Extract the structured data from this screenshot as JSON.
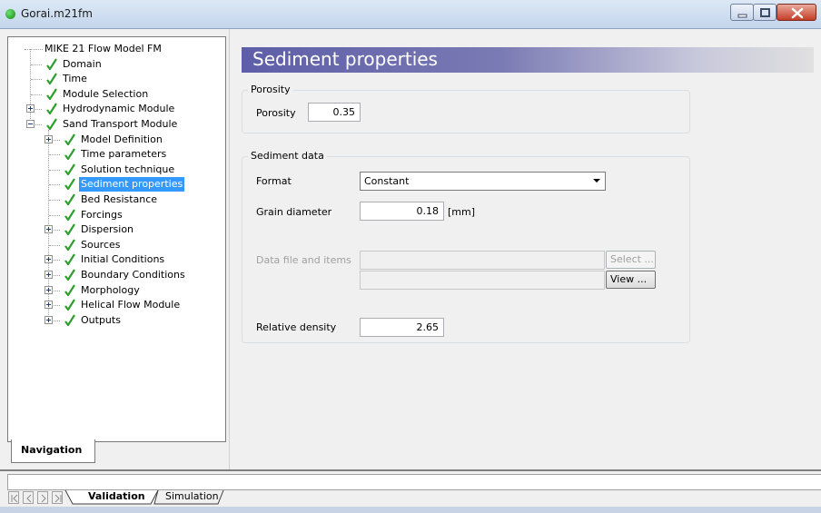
{
  "window": {
    "title": "Gorai.m21fm"
  },
  "navigation": {
    "tab_label": "Navigation",
    "tree": [
      {
        "label": "MIKE 21 Flow Model FM",
        "level": 0,
        "expander": null,
        "check": false
      },
      {
        "label": "Domain",
        "level": 1,
        "expander": null,
        "check": true
      },
      {
        "label": "Time",
        "level": 1,
        "expander": null,
        "check": true
      },
      {
        "label": "Module Selection",
        "level": 1,
        "expander": null,
        "check": true
      },
      {
        "label": "Hydrodynamic Module",
        "level": 1,
        "expander": "plus",
        "check": true
      },
      {
        "label": "Sand Transport Module",
        "level": 1,
        "expander": "minus",
        "check": true
      },
      {
        "label": "Model Definition",
        "level": 2,
        "expander": "plus",
        "check": true
      },
      {
        "label": "Time parameters",
        "level": 2,
        "expander": null,
        "check": true
      },
      {
        "label": "Solution technique",
        "level": 2,
        "expander": null,
        "check": true
      },
      {
        "label": "Sediment properties",
        "level": 2,
        "expander": null,
        "check": true,
        "selected": true
      },
      {
        "label": "Bed Resistance",
        "level": 2,
        "expander": null,
        "check": true
      },
      {
        "label": "Forcings",
        "level": 2,
        "expander": null,
        "check": true
      },
      {
        "label": "Dispersion",
        "level": 2,
        "expander": "plus",
        "check": true
      },
      {
        "label": "Sources",
        "level": 2,
        "expander": null,
        "check": true
      },
      {
        "label": "Initial Conditions",
        "level": 2,
        "expander": "plus",
        "check": true
      },
      {
        "label": "Boundary Conditions",
        "level": 2,
        "expander": "plus",
        "check": true
      },
      {
        "label": "Morphology",
        "level": 2,
        "expander": "plus",
        "check": true
      },
      {
        "label": "Helical Flow Module",
        "level": 2,
        "expander": "plus",
        "check": true
      },
      {
        "label": "Outputs",
        "level": 2,
        "expander": "plus",
        "check": true
      }
    ]
  },
  "page": {
    "title": "Sediment properties",
    "porosity_group": {
      "title": "Porosity",
      "porosity_label": "Porosity",
      "porosity_value": "0.35"
    },
    "sediment_group": {
      "title": "Sediment data",
      "format_label": "Format",
      "format_value": "Constant",
      "grain_label": "Grain diameter",
      "grain_value": "0.18",
      "grain_unit": "[mm]",
      "datafile_label": "Data file and items",
      "select_button": "Select ...",
      "view_button": "View ...",
      "density_label": "Relative density",
      "density_value": "2.65"
    }
  },
  "bottom_tabs": {
    "validation": "Validation",
    "simulation": "Simulation"
  },
  "colors": {
    "check_green": "#2f9e2f",
    "selection_blue": "#3399ff",
    "banner_start": "#5d5ea8"
  }
}
